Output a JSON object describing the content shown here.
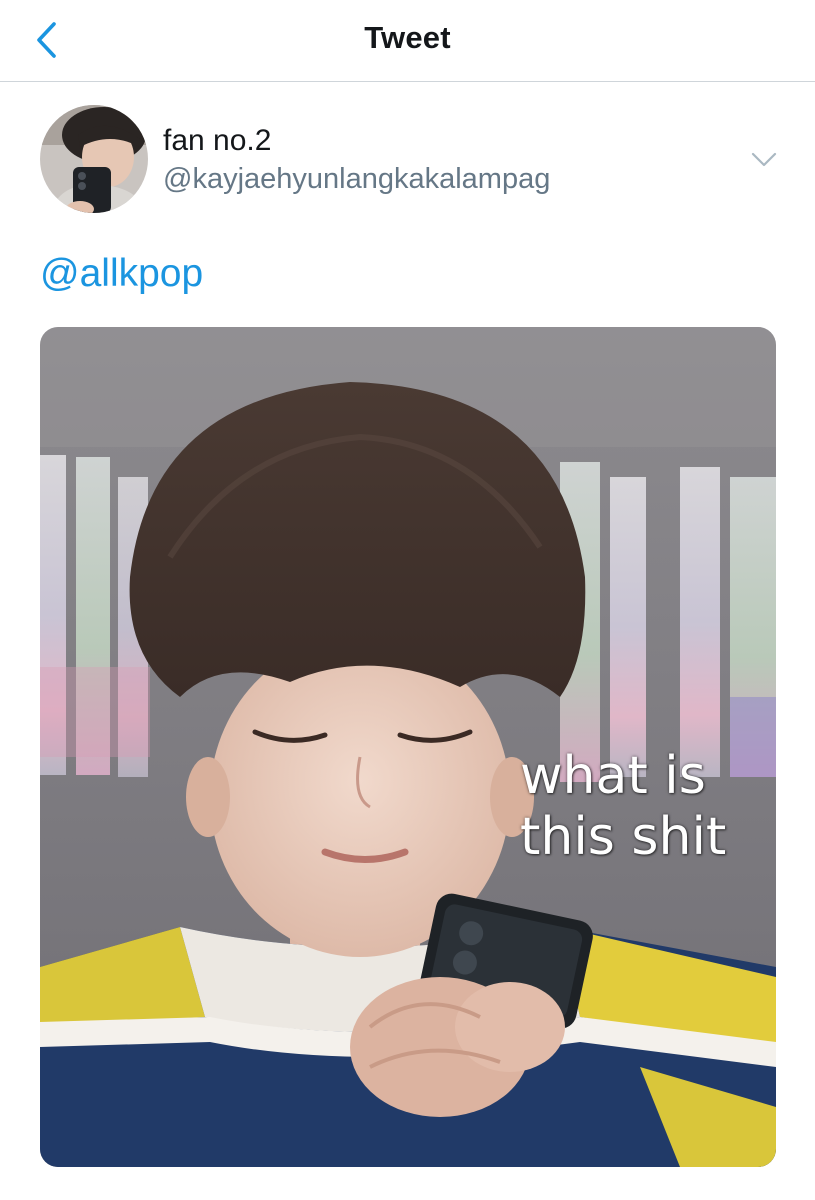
{
  "header": {
    "title": "Tweet",
    "back_icon": "chevron-left-icon"
  },
  "author": {
    "display_name": "fan no.2",
    "handle": "@kayjaehyunlangkakalampag",
    "menu_icon": "chevron-down-icon"
  },
  "tweet": {
    "text": "@allkpop"
  },
  "media": {
    "caption_lines": [
      "what is",
      "this shit"
    ]
  },
  "colors": {
    "accent": "#1b95e0",
    "text_primary": "#14171a",
    "text_secondary": "#657786",
    "divider": "#cfd5da"
  }
}
